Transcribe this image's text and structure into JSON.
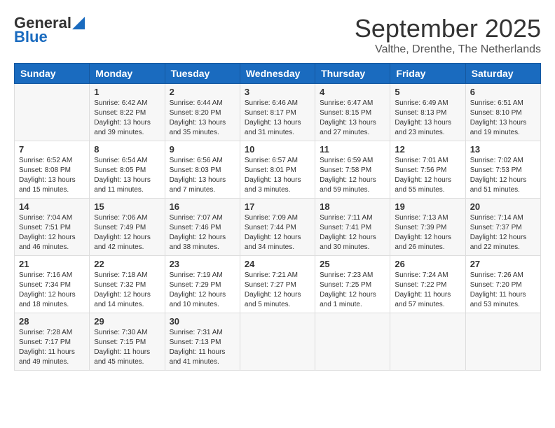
{
  "logo": {
    "general": "General",
    "blue": "Blue"
  },
  "title": "September 2025",
  "location": "Valthe, Drenthe, The Netherlands",
  "weekdays": [
    "Sunday",
    "Monday",
    "Tuesday",
    "Wednesday",
    "Thursday",
    "Friday",
    "Saturday"
  ],
  "weeks": [
    [
      {
        "day": "",
        "info": ""
      },
      {
        "day": "1",
        "info": "Sunrise: 6:42 AM\nSunset: 8:22 PM\nDaylight: 13 hours\nand 39 minutes."
      },
      {
        "day": "2",
        "info": "Sunrise: 6:44 AM\nSunset: 8:20 PM\nDaylight: 13 hours\nand 35 minutes."
      },
      {
        "day": "3",
        "info": "Sunrise: 6:46 AM\nSunset: 8:17 PM\nDaylight: 13 hours\nand 31 minutes."
      },
      {
        "day": "4",
        "info": "Sunrise: 6:47 AM\nSunset: 8:15 PM\nDaylight: 13 hours\nand 27 minutes."
      },
      {
        "day": "5",
        "info": "Sunrise: 6:49 AM\nSunset: 8:13 PM\nDaylight: 13 hours\nand 23 minutes."
      },
      {
        "day": "6",
        "info": "Sunrise: 6:51 AM\nSunset: 8:10 PM\nDaylight: 13 hours\nand 19 minutes."
      }
    ],
    [
      {
        "day": "7",
        "info": "Sunrise: 6:52 AM\nSunset: 8:08 PM\nDaylight: 13 hours\nand 15 minutes."
      },
      {
        "day": "8",
        "info": "Sunrise: 6:54 AM\nSunset: 8:05 PM\nDaylight: 13 hours\nand 11 minutes."
      },
      {
        "day": "9",
        "info": "Sunrise: 6:56 AM\nSunset: 8:03 PM\nDaylight: 13 hours\nand 7 minutes."
      },
      {
        "day": "10",
        "info": "Sunrise: 6:57 AM\nSunset: 8:01 PM\nDaylight: 13 hours\nand 3 minutes."
      },
      {
        "day": "11",
        "info": "Sunrise: 6:59 AM\nSunset: 7:58 PM\nDaylight: 12 hours\nand 59 minutes."
      },
      {
        "day": "12",
        "info": "Sunrise: 7:01 AM\nSunset: 7:56 PM\nDaylight: 12 hours\nand 55 minutes."
      },
      {
        "day": "13",
        "info": "Sunrise: 7:02 AM\nSunset: 7:53 PM\nDaylight: 12 hours\nand 51 minutes."
      }
    ],
    [
      {
        "day": "14",
        "info": "Sunrise: 7:04 AM\nSunset: 7:51 PM\nDaylight: 12 hours\nand 46 minutes."
      },
      {
        "day": "15",
        "info": "Sunrise: 7:06 AM\nSunset: 7:49 PM\nDaylight: 12 hours\nand 42 minutes."
      },
      {
        "day": "16",
        "info": "Sunrise: 7:07 AM\nSunset: 7:46 PM\nDaylight: 12 hours\nand 38 minutes."
      },
      {
        "day": "17",
        "info": "Sunrise: 7:09 AM\nSunset: 7:44 PM\nDaylight: 12 hours\nand 34 minutes."
      },
      {
        "day": "18",
        "info": "Sunrise: 7:11 AM\nSunset: 7:41 PM\nDaylight: 12 hours\nand 30 minutes."
      },
      {
        "day": "19",
        "info": "Sunrise: 7:13 AM\nSunset: 7:39 PM\nDaylight: 12 hours\nand 26 minutes."
      },
      {
        "day": "20",
        "info": "Sunrise: 7:14 AM\nSunset: 7:37 PM\nDaylight: 12 hours\nand 22 minutes."
      }
    ],
    [
      {
        "day": "21",
        "info": "Sunrise: 7:16 AM\nSunset: 7:34 PM\nDaylight: 12 hours\nand 18 minutes."
      },
      {
        "day": "22",
        "info": "Sunrise: 7:18 AM\nSunset: 7:32 PM\nDaylight: 12 hours\nand 14 minutes."
      },
      {
        "day": "23",
        "info": "Sunrise: 7:19 AM\nSunset: 7:29 PM\nDaylight: 12 hours\nand 10 minutes."
      },
      {
        "day": "24",
        "info": "Sunrise: 7:21 AM\nSunset: 7:27 PM\nDaylight: 12 hours\nand 5 minutes."
      },
      {
        "day": "25",
        "info": "Sunrise: 7:23 AM\nSunset: 7:25 PM\nDaylight: 12 hours\nand 1 minute."
      },
      {
        "day": "26",
        "info": "Sunrise: 7:24 AM\nSunset: 7:22 PM\nDaylight: 11 hours\nand 57 minutes."
      },
      {
        "day": "27",
        "info": "Sunrise: 7:26 AM\nSunset: 7:20 PM\nDaylight: 11 hours\nand 53 minutes."
      }
    ],
    [
      {
        "day": "28",
        "info": "Sunrise: 7:28 AM\nSunset: 7:17 PM\nDaylight: 11 hours\nand 49 minutes."
      },
      {
        "day": "29",
        "info": "Sunrise: 7:30 AM\nSunset: 7:15 PM\nDaylight: 11 hours\nand 45 minutes."
      },
      {
        "day": "30",
        "info": "Sunrise: 7:31 AM\nSunset: 7:13 PM\nDaylight: 11 hours\nand 41 minutes."
      },
      {
        "day": "",
        "info": ""
      },
      {
        "day": "",
        "info": ""
      },
      {
        "day": "",
        "info": ""
      },
      {
        "day": "",
        "info": ""
      }
    ]
  ]
}
